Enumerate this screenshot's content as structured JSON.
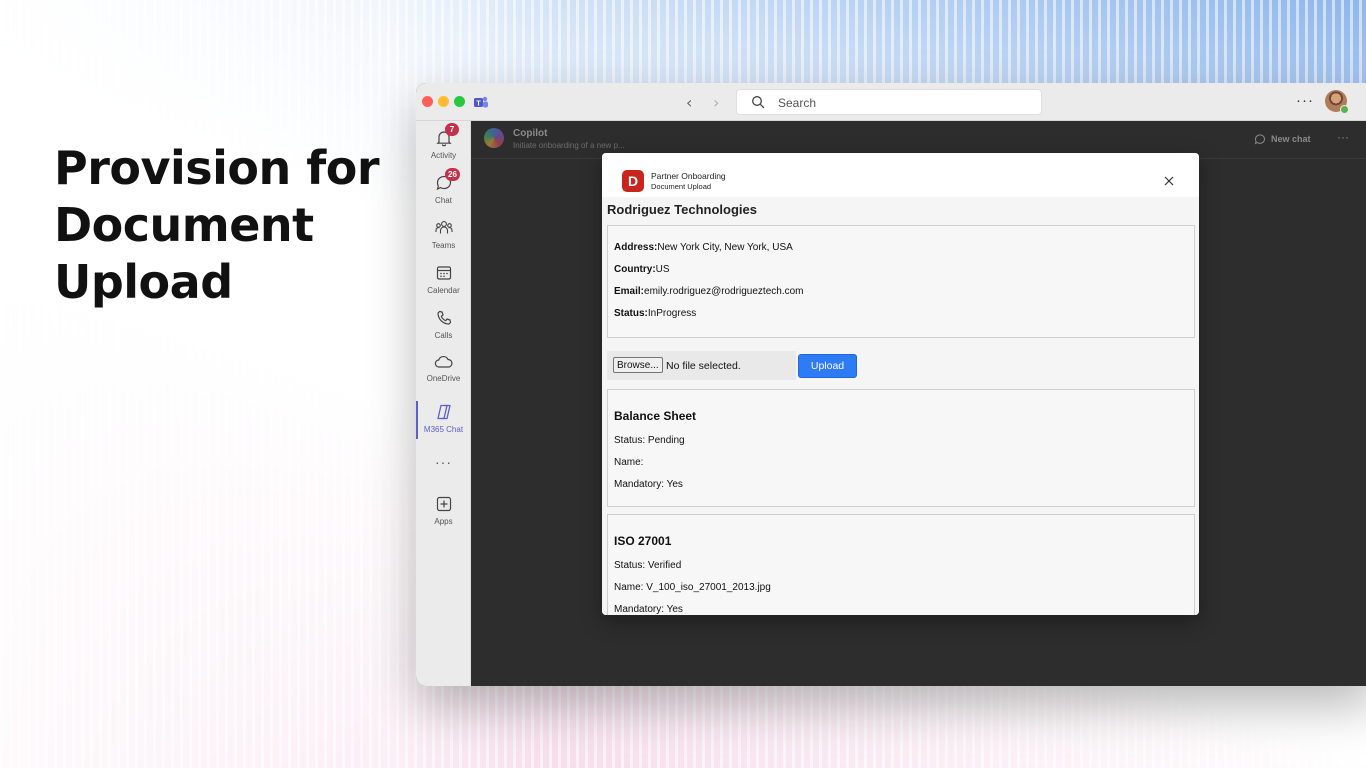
{
  "headline": [
    "Provision for",
    "Document",
    "Upload"
  ],
  "titlebar": {
    "search_placeholder": "Search",
    "more": "···"
  },
  "rail": {
    "items": [
      {
        "label": "Activity",
        "badge": "7",
        "icon": "bell-icon"
      },
      {
        "label": "Chat",
        "badge": "26",
        "icon": "chat-icon"
      },
      {
        "label": "Teams",
        "icon": "teams-icon"
      },
      {
        "label": "Calendar",
        "icon": "calendar-icon"
      },
      {
        "label": "Calls",
        "icon": "phone-icon"
      },
      {
        "label": "OneDrive",
        "icon": "cloud-icon"
      },
      {
        "label": "M365 Chat",
        "icon": "copilot-icon",
        "active": true
      },
      {
        "label": "···",
        "icon": "more-icon"
      },
      {
        "label": "Apps",
        "icon": "add-app-icon"
      }
    ],
    "accent": "#5b5fc7"
  },
  "content": {
    "title": "Copilot",
    "subtitle": "Initiate onboarding of a new p...",
    "new_chat": "New chat",
    "more": "···"
  },
  "dialog": {
    "app_name": "Partner Onboarding",
    "app_subtitle": "Document Upload",
    "app_icon_letter": "D",
    "company": "Rodriguez Technologies",
    "info": {
      "address_label": "Address:",
      "address": "New York City, New York, USA",
      "country_label": "Country:",
      "country": "US",
      "email_label": "Email:",
      "email": "emily.rodriguez@rodrigueztech.com",
      "status_label": "Status:",
      "status": "InProgress"
    },
    "file": {
      "browse_label": "Browse...",
      "status": "No file selected.",
      "upload_label": "Upload"
    },
    "documents": [
      {
        "title": "Balance Sheet",
        "status": "Status: Pending",
        "name": "Name:",
        "mandatory": "Mandatory: Yes"
      },
      {
        "title": "ISO 27001",
        "status": "Status: Verified",
        "name": "Name: V_100_iso_27001_2013.jpg",
        "mandatory": "Mandatory: Yes"
      }
    ],
    "colors": {
      "brand": "#c8251e",
      "primary_button": "#2f7bf5"
    }
  }
}
